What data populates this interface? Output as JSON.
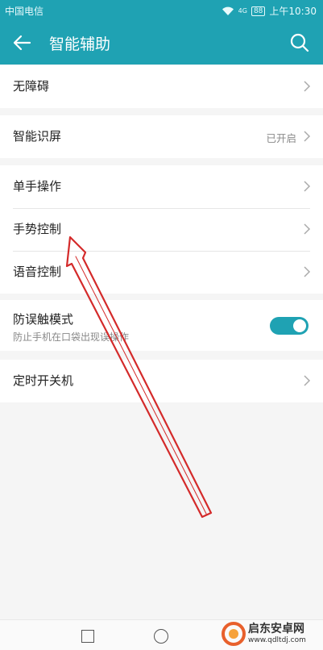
{
  "status_bar": {
    "carrier": "中国电信",
    "network": "4G",
    "battery": "88",
    "time": "上午10:30"
  },
  "app_bar": {
    "title": "智能辅助",
    "back_icon": "arrow-left",
    "search_icon": "search"
  },
  "groups": [
    {
      "items": [
        {
          "label": "无障碍"
        }
      ]
    },
    {
      "items": [
        {
          "label": "智能识屏",
          "value": "已开启"
        }
      ]
    },
    {
      "items": [
        {
          "label": "单手操作"
        },
        {
          "label": "手势控制"
        },
        {
          "label": "语音控制"
        }
      ]
    },
    {
      "items": [
        {
          "label": "防误触模式",
          "subtitle": "防止手机在口袋出现误操作",
          "toggle_on": true
        }
      ]
    },
    {
      "items": [
        {
          "label": "定时开关机"
        }
      ]
    }
  ],
  "annotation": {
    "arrow_color": "#d42a2a"
  },
  "watermark": {
    "brand": "启东安卓网",
    "site": "www.qdltdj.com"
  },
  "colors": {
    "accent": "#1fa2b3",
    "background": "#f5f5f5"
  }
}
